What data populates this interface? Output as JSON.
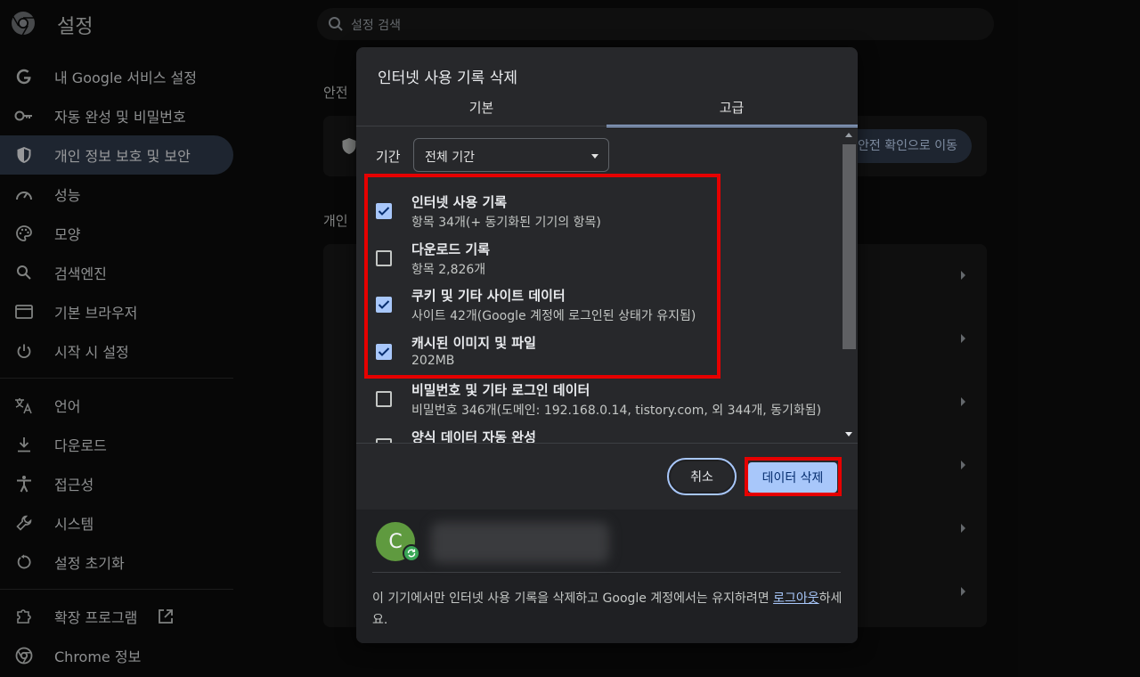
{
  "app": {
    "title": "설정"
  },
  "search": {
    "placeholder": "설정 검색"
  },
  "sidebar": {
    "items": [
      {
        "label": "내 Google 서비스 설정",
        "icon": "google-icon"
      },
      {
        "label": "자동 완성 및 비밀번호",
        "icon": "key-icon"
      },
      {
        "label": "개인 정보 보호 및 보안",
        "icon": "shield-icon",
        "active": true
      },
      {
        "label": "성능",
        "icon": "speedometer-icon"
      },
      {
        "label": "모양",
        "icon": "palette-icon"
      },
      {
        "label": "검색엔진",
        "icon": "search-icon"
      },
      {
        "label": "기본 브라우저",
        "icon": "browser-icon"
      },
      {
        "label": "시작 시 설정",
        "icon": "power-icon"
      }
    ],
    "items2": [
      {
        "label": "언어",
        "icon": "translate-icon"
      },
      {
        "label": "다운로드",
        "icon": "download-icon"
      },
      {
        "label": "접근성",
        "icon": "accessibility-icon"
      },
      {
        "label": "시스템",
        "icon": "wrench-icon"
      },
      {
        "label": "설정 초기화",
        "icon": "reset-icon"
      }
    ],
    "items3": [
      {
        "label": "확장 프로그램",
        "icon": "puzzle-icon"
      },
      {
        "label": "Chrome 정보",
        "icon": "chrome-icon"
      }
    ]
  },
  "main": {
    "section1_heading": "안전 ",
    "safety_button": "안전 확인으로 이동",
    "section2_heading": "개인 "
  },
  "dialog": {
    "title": "인터넷 사용 기록 삭제",
    "tabs": [
      "기본",
      "고급"
    ],
    "active_tab": "고급",
    "period_label": "기간",
    "period_value": "전체 기간",
    "items": [
      {
        "title": "인터넷 사용 기록",
        "subtitle": "항목 34개(+ 동기화된 기기의 항목)",
        "checked": true
      },
      {
        "title": "다운로드 기록",
        "subtitle": "항목 2,826개",
        "checked": false
      },
      {
        "title": "쿠키 및 기타 사이트 데이터",
        "subtitle": "사이트 42개(Google 계정에 로그인된 상태가 유지됨)",
        "checked": true
      },
      {
        "title": "캐시된 이미지 및 파일",
        "subtitle": "202MB",
        "checked": true
      },
      {
        "title": "비밀번호 및 기타 로그인 데이터",
        "subtitle": "비밀번호 346개(도메인: 192.168.0.14, tistory.com, 외 344개, 동기화됨)",
        "checked": false
      },
      {
        "title": "양식 데이터 자동 완성",
        "subtitle": "",
        "checked": false
      }
    ],
    "cancel_label": "취소",
    "delete_label": "데이터 삭제",
    "avatar_letter": "C",
    "note_prefix": "이 기기에서만 인터넷 사용 기록을 삭제하고 Google 계정에서는 유지하려면 ",
    "note_link": "로그아웃",
    "note_suffix": "하세요."
  },
  "colors": {
    "accent": "#a8c7fa",
    "highlight_box": "#e60000",
    "dialog_bg": "#27282b"
  }
}
